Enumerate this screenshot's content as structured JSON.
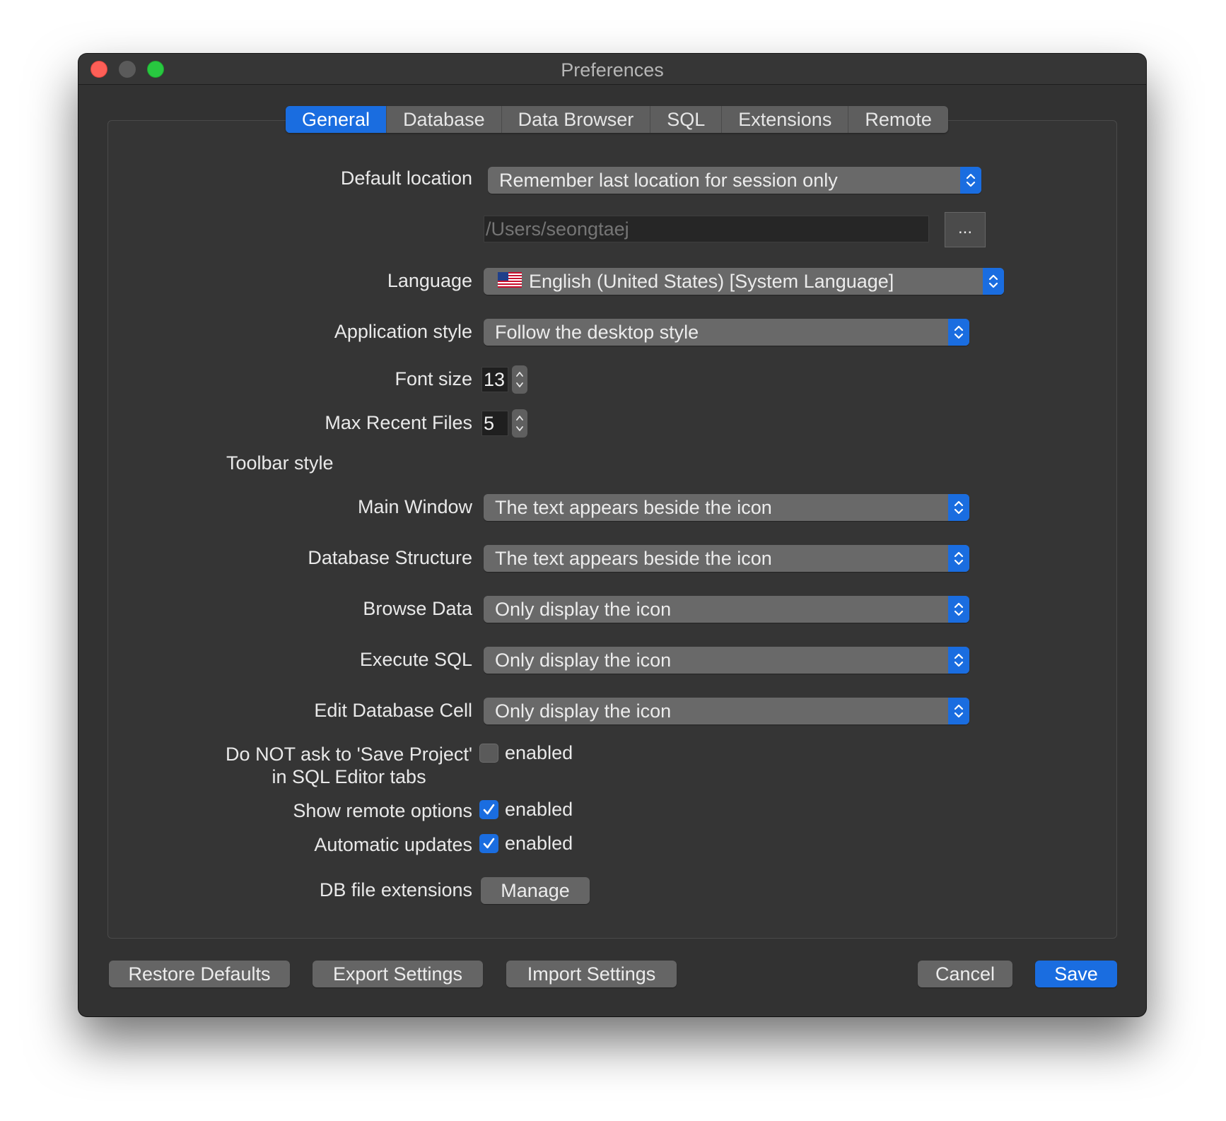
{
  "window": {
    "title": "Preferences"
  },
  "tabs": [
    {
      "label": "General",
      "active": true
    },
    {
      "label": "Database",
      "active": false
    },
    {
      "label": "Data Browser",
      "active": false
    },
    {
      "label": "SQL",
      "active": false
    },
    {
      "label": "Extensions",
      "active": false
    },
    {
      "label": "Remote",
      "active": false
    }
  ],
  "general": {
    "default_location": {
      "label": "Default location",
      "value": "Remember last location for session only"
    },
    "location_path": {
      "placeholder": "/Users/seongtaej",
      "browse_label": "..."
    },
    "language": {
      "label": "Language",
      "value": "English (United States) [System Language]",
      "flag_icon": "us-flag-icon"
    },
    "app_style": {
      "label": "Application style",
      "value": "Follow the desktop style"
    },
    "font_size": {
      "label": "Font size",
      "value": "13"
    },
    "max_recent": {
      "label": "Max Recent Files",
      "value": "5"
    },
    "toolbar_style": {
      "heading": "Toolbar style",
      "main_window": {
        "label": "Main Window",
        "value": "The text appears beside the icon"
      },
      "db_structure": {
        "label": "Database Structure",
        "value": "The text appears beside the icon"
      },
      "browse_data": {
        "label": "Browse Data",
        "value": "Only display the icon"
      },
      "execute_sql": {
        "label": "Execute SQL",
        "value": "Only display the icon"
      },
      "edit_cell": {
        "label": "Edit Database Cell",
        "value": "Only display the icon"
      }
    },
    "no_ask_save": {
      "label_line1": "Do NOT ask to 'Save Project'",
      "label_line2": "in SQL Editor tabs",
      "text": "enabled",
      "checked": false
    },
    "remote_options": {
      "label": "Show remote options",
      "text": "enabled",
      "checked": true
    },
    "auto_updates": {
      "label": "Automatic updates",
      "text": "enabled",
      "checked": true
    },
    "db_ext": {
      "label": "DB file extensions",
      "button": "Manage"
    }
  },
  "footer": {
    "restore": "Restore Defaults",
    "export": "Export Settings",
    "import": "Import Settings",
    "cancel": "Cancel",
    "save": "Save"
  },
  "colors": {
    "accent": "#1a6de0",
    "window_bg": "#323232",
    "control_bg": "#696969"
  }
}
